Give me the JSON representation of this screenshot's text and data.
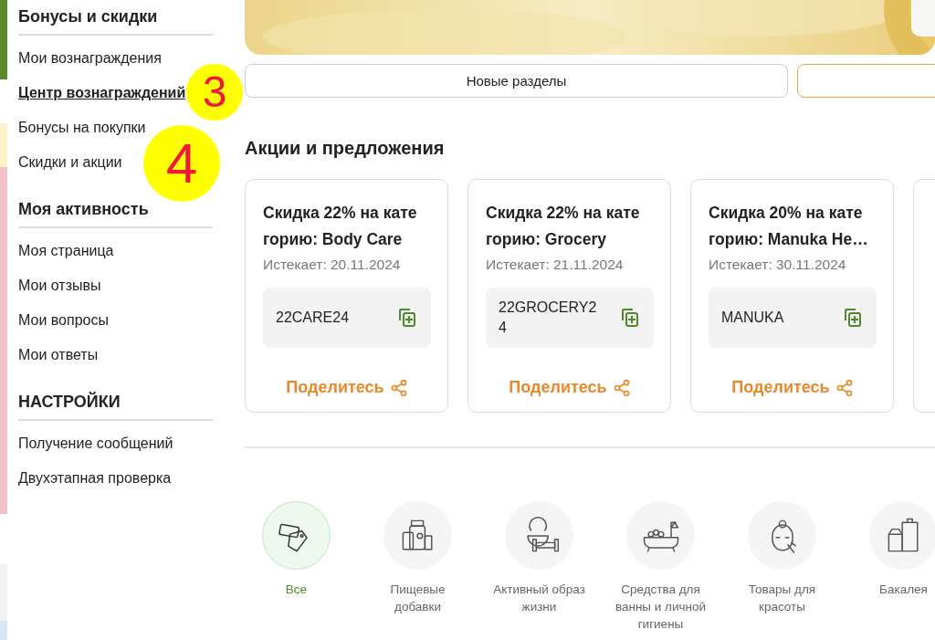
{
  "sidebar": {
    "sections": [
      {
        "title": "Бонусы и скидки",
        "items": [
          {
            "label": "Мои вознаграждения",
            "selected": false
          },
          {
            "label": "Центр вознаграждений",
            "selected": true
          },
          {
            "label": "Бонусы на покупки",
            "selected": false
          },
          {
            "label": "Скидки и акции",
            "selected": false
          }
        ]
      },
      {
        "title": "Моя активность",
        "items": [
          {
            "label": "Моя страница",
            "selected": false
          },
          {
            "label": "Мои отзывы",
            "selected": false
          },
          {
            "label": "Мои вопросы",
            "selected": false
          },
          {
            "label": "Мои ответы",
            "selected": false
          }
        ]
      },
      {
        "title": "НАСТРОЙКИ",
        "items": [
          {
            "label": "Получение сообщений",
            "selected": false
          },
          {
            "label": "Двухэтапная проверка",
            "selected": false
          }
        ]
      }
    ]
  },
  "annotations": [
    {
      "label": "3"
    },
    {
      "label": "4"
    }
  ],
  "tabs": [
    {
      "label": "Новые разделы",
      "selected": false
    },
    {
      "selected": true
    }
  ],
  "offers": {
    "title": "Акции и предложения",
    "cards": [
      {
        "title": "Скидка 22% на кате горию: Body Care",
        "expires": "Истекает: 20.11.2024",
        "code": "22CARE24",
        "share": "Поделитесь"
      },
      {
        "title": "Скидка 22% на кате горию: Grocery",
        "expires": "Истекает: 21.11.2024",
        "code": "22GROCERY24",
        "share": "Поделитесь"
      },
      {
        "title": "Скидка 20% на кате горию: Manuka He…",
        "expires": "Истекает: 30.11.2024",
        "code": "MANUKA",
        "share": "Поделитесь"
      }
    ]
  },
  "categories": [
    {
      "label": "Все",
      "kind": "all",
      "selected": true
    },
    {
      "label": "Пищевые добавки",
      "kind": "supplements",
      "selected": false
    },
    {
      "label": "Активный образ жизни",
      "kind": "fitness",
      "selected": false
    },
    {
      "label": "Средства для ванны и личной гигиены",
      "kind": "bath",
      "selected": false
    },
    {
      "label": "Товары для красоты",
      "kind": "beauty",
      "selected": false
    },
    {
      "label": "Бакалея",
      "kind": "grocery",
      "selected": false
    }
  ]
}
